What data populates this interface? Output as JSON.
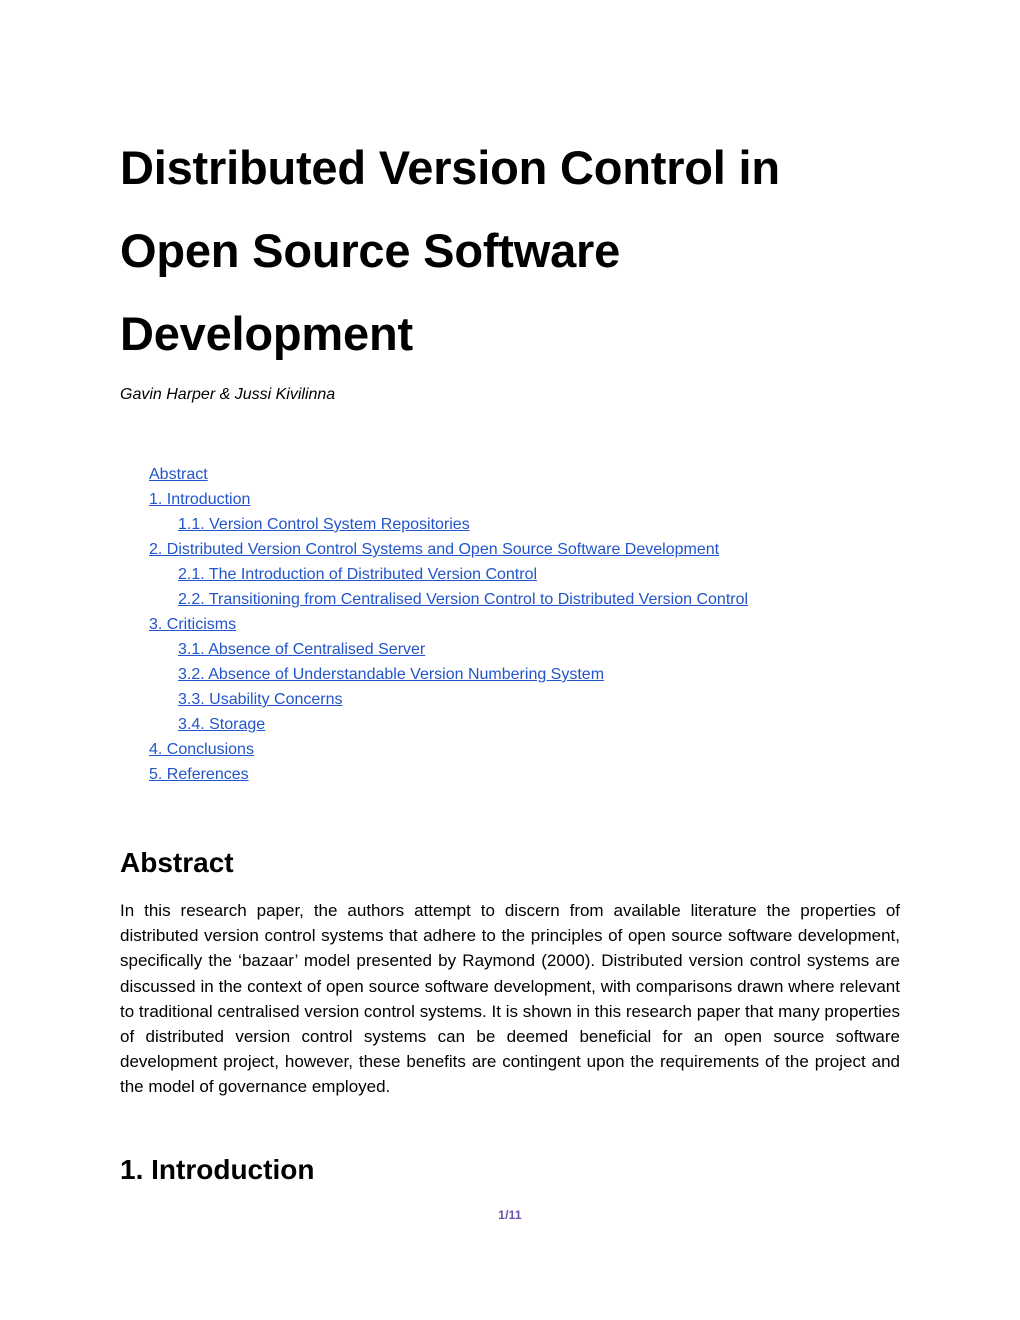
{
  "document": {
    "title": "Distributed Version Control in Open Source Software Development",
    "authors": "Gavin Harper & Jussi Kivilinna",
    "link_color": "#2255cc",
    "page_number_color": "#6b4fa8"
  },
  "toc": {
    "items": [
      {
        "label": "Abstract",
        "level": 1
      },
      {
        "label": "1. Introduction",
        "level": 1
      },
      {
        "label": "1.1. Version Control System Repositories",
        "level": 2
      },
      {
        "label": "2. Distributed Version Control Systems and Open Source Software Development",
        "level": 1
      },
      {
        "label": "2.1. The Introduction of Distributed Version Control",
        "level": 2
      },
      {
        "label": "2.2. Transitioning from Centralised Version Control to Distributed Version Control",
        "level": 2
      },
      {
        "label": "3. Criticisms",
        "level": 1
      },
      {
        "label": "3.1. Absence of Centralised Server",
        "level": 2
      },
      {
        "label": "3.2. Absence of Understandable Version Numbering System",
        "level": 2
      },
      {
        "label": "3.3. Usability Concerns",
        "level": 2
      },
      {
        "label": "3.4. Storage",
        "level": 2
      },
      {
        "label": "4. Conclusions",
        "level": 1
      },
      {
        "label": "5. References",
        "level": 1
      }
    ]
  },
  "sections": {
    "abstract": {
      "heading": "Abstract",
      "paragraph": "In this research paper, the authors attempt to discern from available literature the properties of distributed version control systems that adhere to the principles of open source software development, specifically the ‘bazaar’ model presented by Raymond (2000). Distributed version control systems are discussed in the context of open source software development, with comparisons drawn where relevant to traditional centralised version control systems. It is shown in this research paper that many properties of distributed version control systems can be deemed beneficial for an open source software development project, however, these benefits are contingent upon the requirements of the project and the model of governance employed."
    },
    "introduction": {
      "heading": "1. Introduction"
    }
  },
  "footer": {
    "page_number": "1/11"
  }
}
